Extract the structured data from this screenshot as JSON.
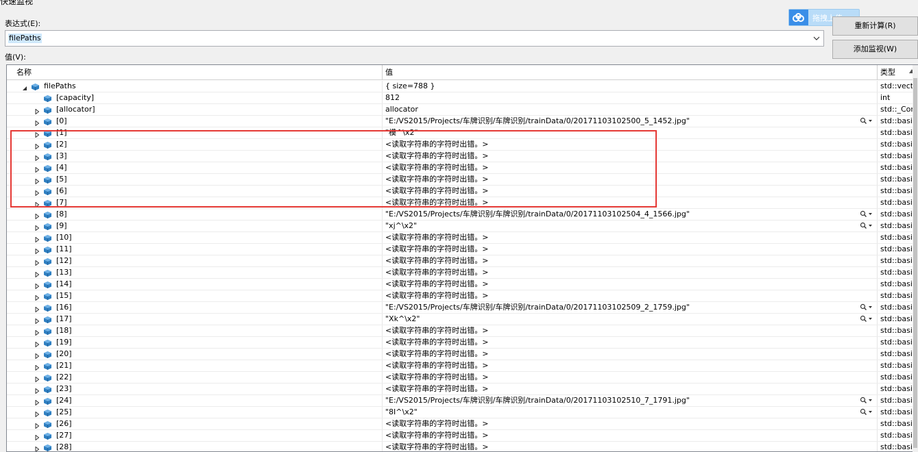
{
  "top_cut_title": "快速监视",
  "expression_label": "表达式(E):",
  "expression_value": "filePaths",
  "value_label": "值(V):",
  "buttons": {
    "recalculate": "重新计算(R)",
    "add_watch": "添加监视(W)"
  },
  "baidu_upload": "拖拽上传",
  "columns": {
    "name": "名称",
    "value": "值",
    "type": "类型"
  },
  "rows": [
    {
      "name": "filePaths",
      "value": "{ size=788 }",
      "type": "std::vect",
      "level": 0,
      "exp": "open",
      "mag": false
    },
    {
      "name": "[capacity]",
      "value": "812",
      "type": "int",
      "level": 1,
      "exp": "none",
      "mag": false
    },
    {
      "name": "[allocator]",
      "value": "allocator",
      "type": "std::_Con",
      "level": 1,
      "exp": "closed",
      "mag": false
    },
    {
      "name": "[0]",
      "value": "\"E:/VS2015/Projects/车牌识别/车牌识别/trainData/0/20171103102500_5_1452.jpg\"",
      "type": "std::basic",
      "level": 1,
      "exp": "closed",
      "mag": true
    },
    {
      "name": "[1]",
      "value": "\"模^\\x2\"",
      "type": "std::basic",
      "level": 1,
      "exp": "closed",
      "mag": false
    },
    {
      "name": "[2]",
      "value": "<读取字符串的字符时出错。>",
      "type": "std::basic",
      "level": 1,
      "exp": "closed",
      "mag": false
    },
    {
      "name": "[3]",
      "value": "<读取字符串的字符时出错。>",
      "type": "std::basic",
      "level": 1,
      "exp": "closed",
      "mag": false
    },
    {
      "name": "[4]",
      "value": "<读取字符串的字符时出错。>",
      "type": "std::basic",
      "level": 1,
      "exp": "closed",
      "mag": false
    },
    {
      "name": "[5]",
      "value": "<读取字符串的字符时出错。>",
      "type": "std::basic",
      "level": 1,
      "exp": "closed",
      "mag": false
    },
    {
      "name": "[6]",
      "value": "<读取字符串的字符时出错。>",
      "type": "std::basic",
      "level": 1,
      "exp": "closed",
      "mag": false
    },
    {
      "name": "[7]",
      "value": "<读取字符串的字符时出错。>",
      "type": "std::basic",
      "level": 1,
      "exp": "closed",
      "mag": false
    },
    {
      "name": "[8]",
      "value": "\"E:/VS2015/Projects/车牌识别/车牌识别/trainData/0/20171103102504_4_1566.jpg\"",
      "type": "std::basic",
      "level": 1,
      "exp": "closed",
      "mag": true
    },
    {
      "name": "[9]",
      "value": "\"xj^\\x2\"",
      "type": "std::basic",
      "level": 1,
      "exp": "closed",
      "mag": true
    },
    {
      "name": "[10]",
      "value": "<读取字符串的字符时出错。>",
      "type": "std::basic",
      "level": 1,
      "exp": "closed",
      "mag": false
    },
    {
      "name": "[11]",
      "value": "<读取字符串的字符时出错。>",
      "type": "std::basic",
      "level": 1,
      "exp": "closed",
      "mag": false
    },
    {
      "name": "[12]",
      "value": "<读取字符串的字符时出错。>",
      "type": "std::basic",
      "level": 1,
      "exp": "closed",
      "mag": false
    },
    {
      "name": "[13]",
      "value": "<读取字符串的字符时出错。>",
      "type": "std::basic",
      "level": 1,
      "exp": "closed",
      "mag": false
    },
    {
      "name": "[14]",
      "value": "<读取字符串的字符时出错。>",
      "type": "std::basic",
      "level": 1,
      "exp": "closed",
      "mag": false
    },
    {
      "name": "[15]",
      "value": "<读取字符串的字符时出错。>",
      "type": "std::basic",
      "level": 1,
      "exp": "closed",
      "mag": false
    },
    {
      "name": "[16]",
      "value": "\"E:/VS2015/Projects/车牌识别/车牌识别/trainData/0/20171103102509_2_1759.jpg\"",
      "type": "std::basic",
      "level": 1,
      "exp": "closed",
      "mag": true
    },
    {
      "name": "[17]",
      "value": "\"Xk^\\x2\"",
      "type": "std::basic",
      "level": 1,
      "exp": "closed",
      "mag": true
    },
    {
      "name": "[18]",
      "value": "<读取字符串的字符时出错。>",
      "type": "std::basic",
      "level": 1,
      "exp": "closed",
      "mag": false
    },
    {
      "name": "[19]",
      "value": "<读取字符串的字符时出错。>",
      "type": "std::basic",
      "level": 1,
      "exp": "closed",
      "mag": false
    },
    {
      "name": "[20]",
      "value": "<读取字符串的字符时出错。>",
      "type": "std::basic",
      "level": 1,
      "exp": "closed",
      "mag": false
    },
    {
      "name": "[21]",
      "value": "<读取字符串的字符时出错。>",
      "type": "std::basic",
      "level": 1,
      "exp": "closed",
      "mag": false
    },
    {
      "name": "[22]",
      "value": "<读取字符串的字符时出错。>",
      "type": "std::basic",
      "level": 1,
      "exp": "closed",
      "mag": false
    },
    {
      "name": "[23]",
      "value": "<读取字符串的字符时出错。>",
      "type": "std::basic",
      "level": 1,
      "exp": "closed",
      "mag": false
    },
    {
      "name": "[24]",
      "value": "\"E:/VS2015/Projects/车牌识别/车牌识别/trainData/0/20171103102510_7_1791.jpg\"",
      "type": "std::basic",
      "level": 1,
      "exp": "closed",
      "mag": true
    },
    {
      "name": "[25]",
      "value": "\"8I^\\x2\"",
      "type": "std::basic",
      "level": 1,
      "exp": "closed",
      "mag": true
    },
    {
      "name": "[26]",
      "value": "<读取字符串的字符时出错。>",
      "type": "std::basic",
      "level": 1,
      "exp": "closed",
      "mag": false
    },
    {
      "name": "[27]",
      "value": "<读取字符串的字符时出错。>",
      "type": "std::basic",
      "level": 1,
      "exp": "closed",
      "mag": false
    },
    {
      "name": "[28]",
      "value": "<读取字符串的字符时出错。>",
      "type": "std::basic",
      "level": 1,
      "exp": "closed",
      "mag": false
    }
  ],
  "colors": {
    "icon_blue": "#2f7fc1",
    "highlight_red": "#e53935",
    "selection": "#cfe8fc"
  },
  "icons": {
    "object": "cube-icon",
    "expander_open": "triangle-down-icon",
    "expander_closed": "triangle-right-icon",
    "visualizer": "magnifier-icon"
  }
}
